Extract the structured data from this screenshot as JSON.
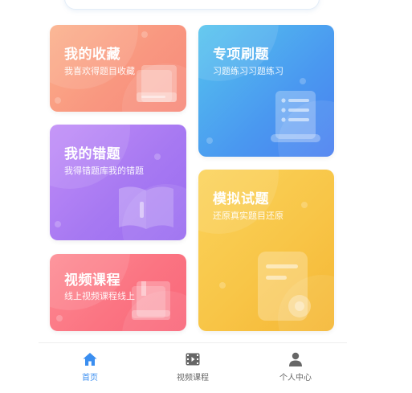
{
  "cards": {
    "favorites": {
      "title": "我的收藏",
      "subtitle": "我喜欢得题目收藏"
    },
    "special": {
      "title": "专项刷题",
      "subtitle": "习题练习习题练习"
    },
    "mistakes": {
      "title": "我的错题",
      "subtitle": "我得错题库我的错题"
    },
    "mock": {
      "title": "模拟试题",
      "subtitle": "还原真实题目还原"
    },
    "video": {
      "title": "视频课程",
      "subtitle": "线上视频课程线上"
    }
  },
  "tabbar": {
    "active": "home",
    "items": [
      {
        "id": "home",
        "label": "首页",
        "icon": "home-icon"
      },
      {
        "id": "video",
        "label": "视频课程",
        "icon": "video-icon"
      },
      {
        "id": "profile",
        "label": "个人中心",
        "icon": "user-icon"
      }
    ]
  },
  "colors": {
    "active_tab": "#3a8ef0",
    "inactive_tab": "#666666",
    "favorites": "#f99780",
    "special": "#4a98f0",
    "mistakes": "#a779f2",
    "mock": "#f8c547",
    "video": "#fb7482"
  }
}
